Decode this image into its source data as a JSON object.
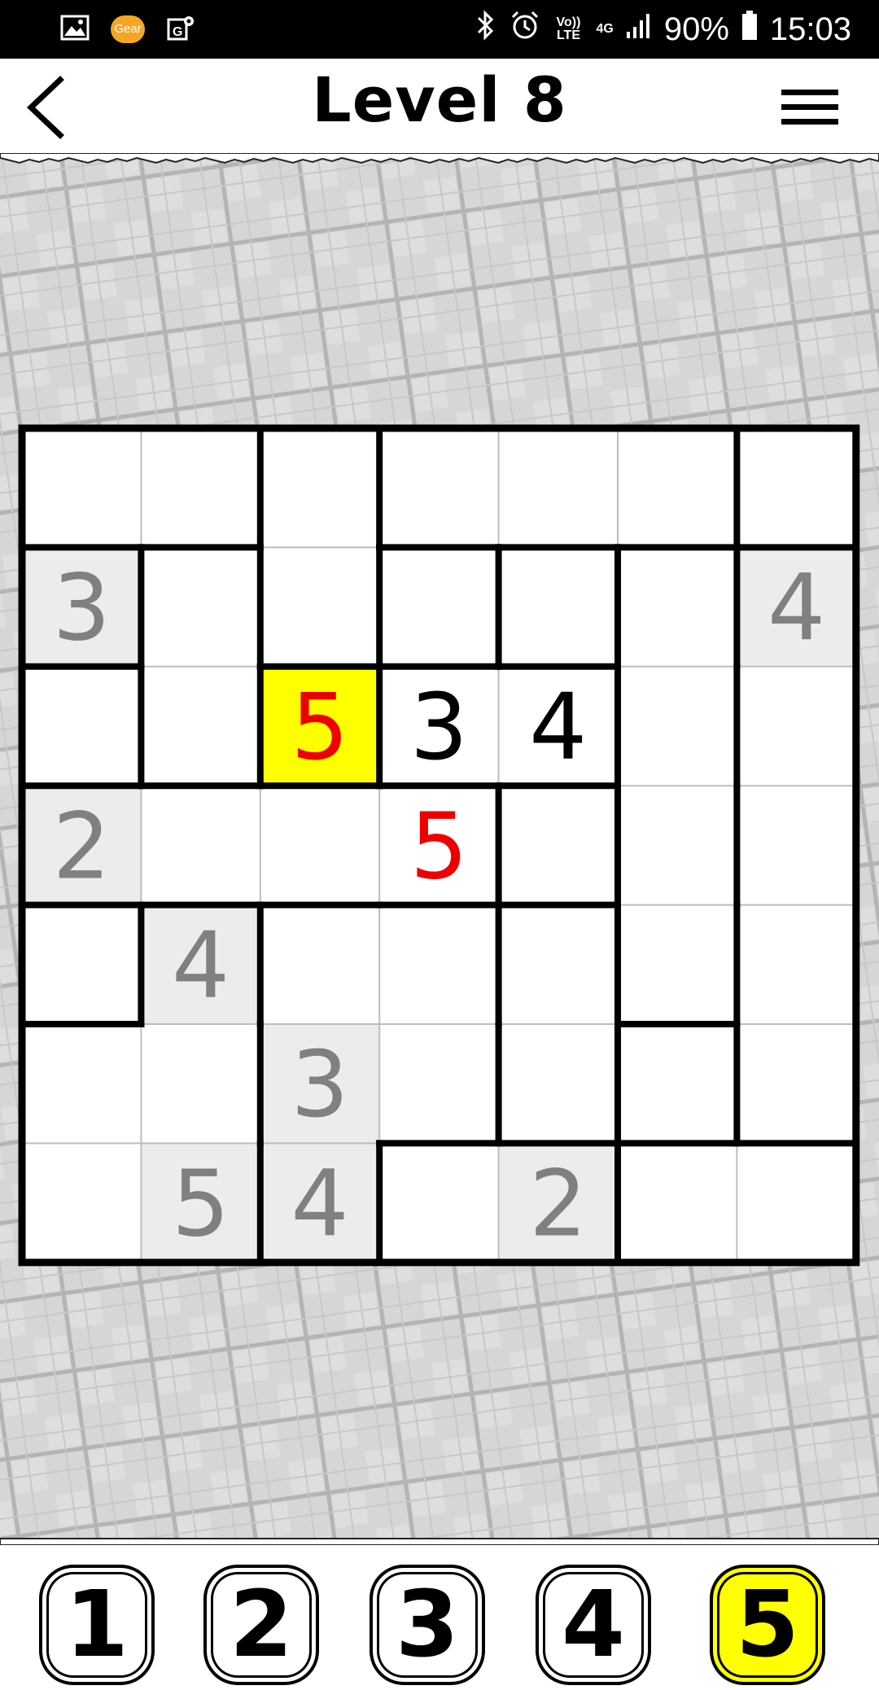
{
  "status_bar": {
    "battery": "90%",
    "time": "15:03",
    "gear_label": "Gear",
    "network": "4G",
    "volte": "Vo)) LTE"
  },
  "header": {
    "title": "Level 8"
  },
  "board": {
    "size": 7,
    "cells": [
      [
        "",
        "",
        "",
        "",
        "",
        "",
        ""
      ],
      [
        "3",
        "",
        "",
        "",
        "",
        "",
        "4"
      ],
      [
        "",
        "",
        "5",
        "3",
        "4",
        "",
        ""
      ],
      [
        "2",
        "",
        "",
        "5",
        "",
        "",
        ""
      ],
      [
        "",
        "4",
        "",
        "",
        "",
        "",
        ""
      ],
      [
        "",
        "",
        "3",
        "",
        "",
        "",
        ""
      ],
      [
        "",
        "5",
        "4",
        "",
        "2",
        "",
        ""
      ]
    ],
    "cell_state": [
      [
        "",
        "",
        "",
        "",
        "",
        "",
        ""
      ],
      [
        "given",
        "",
        "",
        "",
        "",
        "",
        "given"
      ],
      [
        "",
        "",
        "error",
        "user",
        "user",
        "",
        ""
      ],
      [
        "given",
        "",
        "",
        "error",
        "",
        "",
        ""
      ],
      [
        "",
        "given",
        "",
        "",
        "",
        "",
        ""
      ],
      [
        "",
        "",
        "given",
        "",
        "",
        "",
        ""
      ],
      [
        "",
        "given",
        "given",
        "",
        "given",
        "",
        ""
      ]
    ],
    "selected": [
      2,
      2
    ],
    "regions": [
      [
        0,
        0,
        1,
        2,
        2,
        2,
        3
      ],
      [
        4,
        5,
        1,
        6,
        7,
        8,
        9
      ],
      [
        10,
        5,
        11,
        12,
        12,
        8,
        9
      ],
      [
        13,
        13,
        13,
        13,
        14,
        8,
        9
      ],
      [
        15,
        16,
        17,
        17,
        18,
        8,
        9
      ],
      [
        16,
        16,
        17,
        17,
        18,
        19,
        9
      ],
      [
        16,
        16,
        17,
        20,
        20,
        21,
        21
      ]
    ],
    "colors": {
      "given_bg": "#ececec",
      "given_text": "#808080",
      "user_text": "#000000",
      "error_text": "#ee0000",
      "selected_bg": "#ffff00"
    }
  },
  "number_pad": [
    {
      "label": "1",
      "active": false
    },
    {
      "label": "2",
      "active": false
    },
    {
      "label": "3",
      "active": false
    },
    {
      "label": "4",
      "active": false
    },
    {
      "label": "5",
      "active": true
    }
  ],
  "icons": {
    "back": "back-arrow-icon",
    "menu": "hamburger-menu-icon",
    "gallery": "gallery-icon",
    "gear": "gear-app-icon",
    "maps": "maps-icon",
    "bluetooth": "bluetooth-icon",
    "alarm": "alarm-icon",
    "signal": "signal-icon",
    "battery": "battery-icon"
  }
}
